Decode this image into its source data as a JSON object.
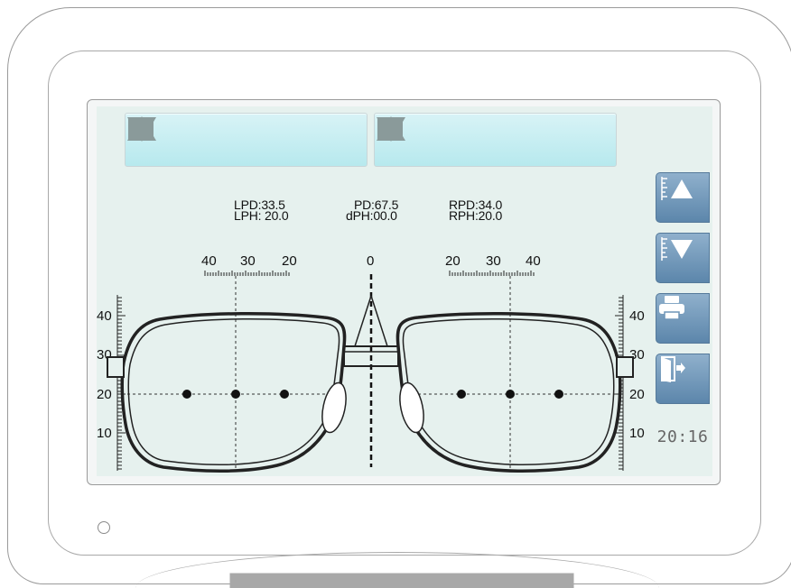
{
  "nav_left": [
    {
      "name": "left-arrow-icon",
      "dir": "left"
    },
    {
      "name": "right-arrow-icon",
      "dir": "right"
    },
    {
      "name": "up-arrow-icon",
      "dir": "up"
    },
    {
      "name": "down-arrow-icon",
      "dir": "down"
    }
  ],
  "nav_right": [
    {
      "name": "left-arrow-icon",
      "dir": "left"
    },
    {
      "name": "right-arrow-icon",
      "dir": "right"
    },
    {
      "name": "up-arrow-icon",
      "dir": "up"
    },
    {
      "name": "down-arrow-icon",
      "dir": "down"
    }
  ],
  "readings": {
    "lpd": "LPD:33.5",
    "lph": "LPH: 20.0",
    "pd": "PD:67.5",
    "dph": "dPH:00.0",
    "rpd": "RPD:34.0",
    "rph": "RPH:20.0"
  },
  "top_scale": {
    "left": [
      "40",
      "30",
      "20"
    ],
    "center": "0",
    "right": [
      "20",
      "30",
      "40"
    ]
  },
  "side_scale": {
    "left": [
      "40",
      "30",
      "20",
      "10"
    ],
    "right": [
      "40",
      "30",
      "20",
      "10"
    ]
  },
  "side_buttons": [
    {
      "name": "ruler-up-button",
      "icon": "ruler-up-icon"
    },
    {
      "name": "ruler-down-button",
      "icon": "ruler-down-icon"
    },
    {
      "name": "print-button",
      "icon": "printer-icon"
    },
    {
      "name": "exit-button",
      "icon": "exit-door-icon"
    }
  ],
  "clock": "20:16",
  "colors": {
    "screen_bg": "#e6f1ee",
    "nav_bg": "#c4eef2",
    "arrow": "#8a9a9a",
    "side_button": "#6f95b8",
    "frame_line": "#222222"
  }
}
